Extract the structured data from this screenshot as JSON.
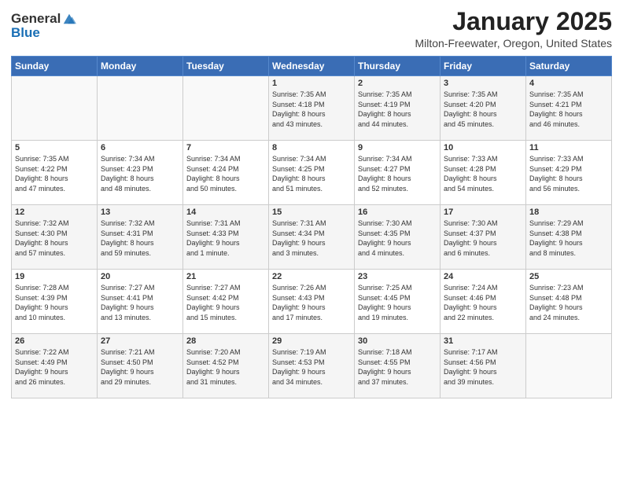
{
  "header": {
    "logo_line1": "General",
    "logo_line2": "Blue",
    "title": "January 2025",
    "subtitle": "Milton-Freewater, Oregon, United States"
  },
  "days_of_week": [
    "Sunday",
    "Monday",
    "Tuesday",
    "Wednesday",
    "Thursday",
    "Friday",
    "Saturday"
  ],
  "weeks": [
    [
      {
        "day": "",
        "info": ""
      },
      {
        "day": "",
        "info": ""
      },
      {
        "day": "",
        "info": ""
      },
      {
        "day": "1",
        "info": "Sunrise: 7:35 AM\nSunset: 4:18 PM\nDaylight: 8 hours\nand 43 minutes."
      },
      {
        "day": "2",
        "info": "Sunrise: 7:35 AM\nSunset: 4:19 PM\nDaylight: 8 hours\nand 44 minutes."
      },
      {
        "day": "3",
        "info": "Sunrise: 7:35 AM\nSunset: 4:20 PM\nDaylight: 8 hours\nand 45 minutes."
      },
      {
        "day": "4",
        "info": "Sunrise: 7:35 AM\nSunset: 4:21 PM\nDaylight: 8 hours\nand 46 minutes."
      }
    ],
    [
      {
        "day": "5",
        "info": "Sunrise: 7:35 AM\nSunset: 4:22 PM\nDaylight: 8 hours\nand 47 minutes."
      },
      {
        "day": "6",
        "info": "Sunrise: 7:34 AM\nSunset: 4:23 PM\nDaylight: 8 hours\nand 48 minutes."
      },
      {
        "day": "7",
        "info": "Sunrise: 7:34 AM\nSunset: 4:24 PM\nDaylight: 8 hours\nand 50 minutes."
      },
      {
        "day": "8",
        "info": "Sunrise: 7:34 AM\nSunset: 4:25 PM\nDaylight: 8 hours\nand 51 minutes."
      },
      {
        "day": "9",
        "info": "Sunrise: 7:34 AM\nSunset: 4:27 PM\nDaylight: 8 hours\nand 52 minutes."
      },
      {
        "day": "10",
        "info": "Sunrise: 7:33 AM\nSunset: 4:28 PM\nDaylight: 8 hours\nand 54 minutes."
      },
      {
        "day": "11",
        "info": "Sunrise: 7:33 AM\nSunset: 4:29 PM\nDaylight: 8 hours\nand 56 minutes."
      }
    ],
    [
      {
        "day": "12",
        "info": "Sunrise: 7:32 AM\nSunset: 4:30 PM\nDaylight: 8 hours\nand 57 minutes."
      },
      {
        "day": "13",
        "info": "Sunrise: 7:32 AM\nSunset: 4:31 PM\nDaylight: 8 hours\nand 59 minutes."
      },
      {
        "day": "14",
        "info": "Sunrise: 7:31 AM\nSunset: 4:33 PM\nDaylight: 9 hours\nand 1 minute."
      },
      {
        "day": "15",
        "info": "Sunrise: 7:31 AM\nSunset: 4:34 PM\nDaylight: 9 hours\nand 3 minutes."
      },
      {
        "day": "16",
        "info": "Sunrise: 7:30 AM\nSunset: 4:35 PM\nDaylight: 9 hours\nand 4 minutes."
      },
      {
        "day": "17",
        "info": "Sunrise: 7:30 AM\nSunset: 4:37 PM\nDaylight: 9 hours\nand 6 minutes."
      },
      {
        "day": "18",
        "info": "Sunrise: 7:29 AM\nSunset: 4:38 PM\nDaylight: 9 hours\nand 8 minutes."
      }
    ],
    [
      {
        "day": "19",
        "info": "Sunrise: 7:28 AM\nSunset: 4:39 PM\nDaylight: 9 hours\nand 10 minutes."
      },
      {
        "day": "20",
        "info": "Sunrise: 7:27 AM\nSunset: 4:41 PM\nDaylight: 9 hours\nand 13 minutes."
      },
      {
        "day": "21",
        "info": "Sunrise: 7:27 AM\nSunset: 4:42 PM\nDaylight: 9 hours\nand 15 minutes."
      },
      {
        "day": "22",
        "info": "Sunrise: 7:26 AM\nSunset: 4:43 PM\nDaylight: 9 hours\nand 17 minutes."
      },
      {
        "day": "23",
        "info": "Sunrise: 7:25 AM\nSunset: 4:45 PM\nDaylight: 9 hours\nand 19 minutes."
      },
      {
        "day": "24",
        "info": "Sunrise: 7:24 AM\nSunset: 4:46 PM\nDaylight: 9 hours\nand 22 minutes."
      },
      {
        "day": "25",
        "info": "Sunrise: 7:23 AM\nSunset: 4:48 PM\nDaylight: 9 hours\nand 24 minutes."
      }
    ],
    [
      {
        "day": "26",
        "info": "Sunrise: 7:22 AM\nSunset: 4:49 PM\nDaylight: 9 hours\nand 26 minutes."
      },
      {
        "day": "27",
        "info": "Sunrise: 7:21 AM\nSunset: 4:50 PM\nDaylight: 9 hours\nand 29 minutes."
      },
      {
        "day": "28",
        "info": "Sunrise: 7:20 AM\nSunset: 4:52 PM\nDaylight: 9 hours\nand 31 minutes."
      },
      {
        "day": "29",
        "info": "Sunrise: 7:19 AM\nSunset: 4:53 PM\nDaylight: 9 hours\nand 34 minutes."
      },
      {
        "day": "30",
        "info": "Sunrise: 7:18 AM\nSunset: 4:55 PM\nDaylight: 9 hours\nand 37 minutes."
      },
      {
        "day": "31",
        "info": "Sunrise: 7:17 AM\nSunset: 4:56 PM\nDaylight: 9 hours\nand 39 minutes."
      },
      {
        "day": "",
        "info": ""
      }
    ]
  ]
}
